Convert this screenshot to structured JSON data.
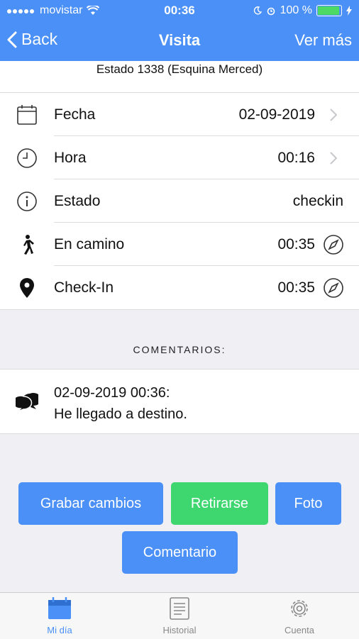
{
  "status_bar": {
    "carrier": "movistar",
    "time": "00:36",
    "battery": "100 %"
  },
  "nav": {
    "back": "Back",
    "title": "Visita",
    "more": "Ver más"
  },
  "subtitle": "Estado 1338 (Esquina Merced)",
  "rows": [
    {
      "label": "Fecha",
      "value": "02-09-2019",
      "icon": "calendar-icon",
      "trail": "chevron-right-icon"
    },
    {
      "label": "Hora",
      "value": "00:16",
      "icon": "clock-icon",
      "trail": "chevron-right-icon"
    },
    {
      "label": "Estado",
      "value": "checkin",
      "icon": "info-icon",
      "trail": ""
    },
    {
      "label": "En camino",
      "value": "00:35",
      "icon": "walking-icon",
      "trail": "compass-icon"
    },
    {
      "label": "Check-In",
      "value": "00:35",
      "icon": "location-pin-icon",
      "trail": "compass-icon"
    }
  ],
  "comments": {
    "header": "COMENTARIOS:",
    "items": [
      {
        "date": "02-09-2019 00:36:",
        "text": "He llegado a destino.",
        "icon": "chat-bubbles-icon"
      }
    ]
  },
  "actions": {
    "save": "Grabar cambios",
    "leave": "Retirarse",
    "photo": "Foto",
    "comment": "Comentario"
  },
  "tabs": [
    {
      "label": "Mi día",
      "icon": "calendar-icon",
      "active": true
    },
    {
      "label": "Historial",
      "icon": "document-icon",
      "active": false
    },
    {
      "label": "Cuenta",
      "icon": "gear-icon",
      "active": false
    }
  ],
  "colors": {
    "accent": "#4a90f6",
    "green": "#3dd66f",
    "background": "#efeff4"
  }
}
